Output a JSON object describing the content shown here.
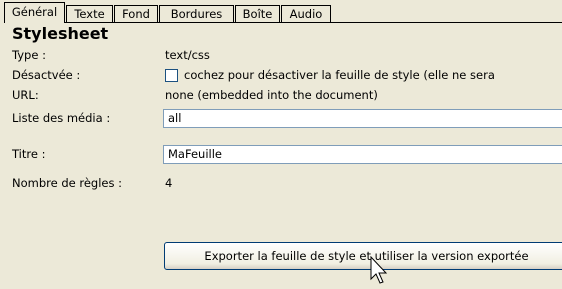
{
  "tabs": [
    "Général",
    "Texte",
    "Fond",
    "Bordures",
    "Boîte",
    "Audio"
  ],
  "section": {
    "title": "Stylesheet"
  },
  "fields": {
    "type_label": "Type :",
    "type_value": "text/css",
    "disabled_label": "Désactvée :",
    "disabled_checkbox_text": "cochez pour désactiver la feuille de style (elle ne sera",
    "disabled_checked": false,
    "url_label": "URL:",
    "url_value": "none (embedded into the document)",
    "media_label": "Liste des média :",
    "media_value": "all",
    "title_label": "Titre :",
    "title_value": "MaFeuille",
    "rules_label": "Nombre de règles :",
    "rules_value": "4"
  },
  "actions": {
    "export_button": "Exporter la feuille de style et utiliser la version exportée"
  },
  "icons": {
    "cursor": "arrow-cursor-icon"
  }
}
